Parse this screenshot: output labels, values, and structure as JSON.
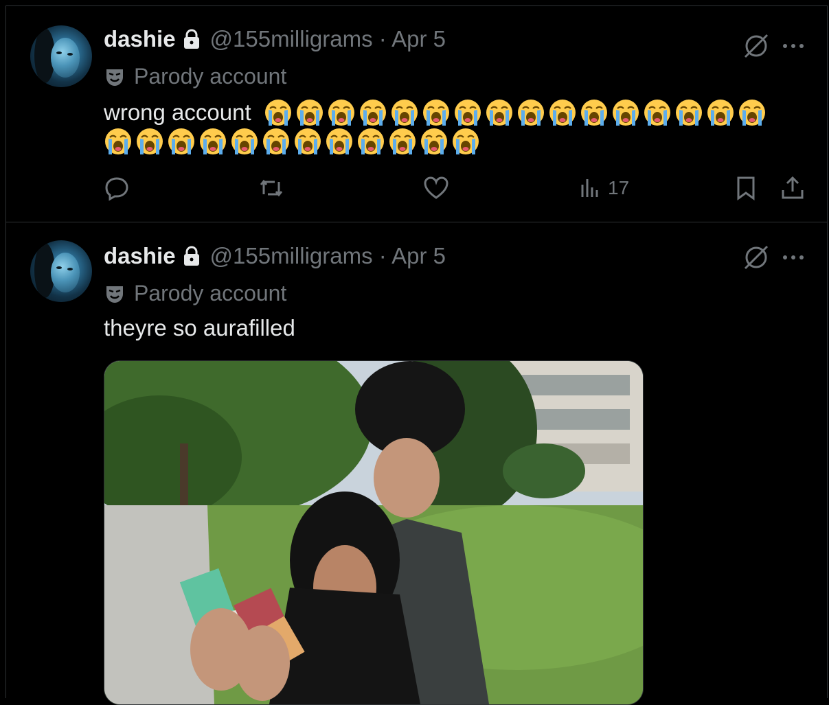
{
  "tweets": [
    {
      "name": "dashie",
      "handle_date": "@155milligrams · Apr 5",
      "badge": "Parody account",
      "text": "wrong account",
      "emoji_count_line1": 16,
      "emoji_count_line2": 12,
      "actions": {
        "views": "17"
      }
    },
    {
      "name": "dashie",
      "handle_date": "@155milligrams · Apr 5",
      "badge": "Parody account",
      "text": "theyre so aurafilled"
    }
  ],
  "icons": {
    "lock": "lock-icon",
    "parody": "parody-mask-icon",
    "grok": "grok-icon",
    "more": "more-icon",
    "reply": "reply-icon",
    "retweet": "retweet-icon",
    "like": "like-icon",
    "views": "views-icon",
    "bookmark": "bookmark-icon",
    "share": "share-icon",
    "emoji": "loudly-crying-face-emoji"
  },
  "colors": {
    "background": "#000000",
    "text": "#e7e9ea",
    "muted": "#71767b",
    "divider": "#2f3336"
  }
}
